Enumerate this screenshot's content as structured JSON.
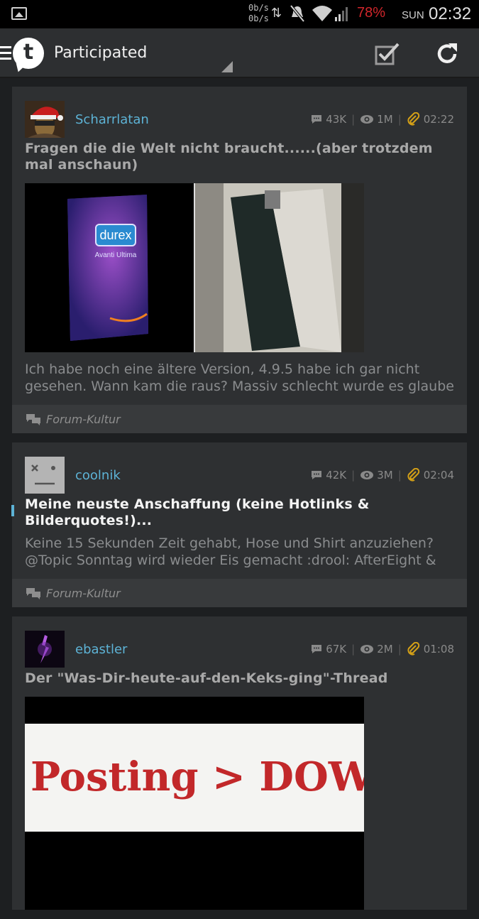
{
  "status_bar": {
    "net_up": "0b/s",
    "net_down": "0b/s",
    "battery": "78%",
    "day": "SUN",
    "time": "02:32"
  },
  "app_bar": {
    "logo_letter": "t",
    "title": "Participated"
  },
  "threads": [
    {
      "username": "Scharrlatan",
      "replies": "43K",
      "views": "1M",
      "time": "02:22",
      "title": "Fragen die die Welt nicht braucht......(aber trotzdem mal anschaun)",
      "excerpt": "Ich habe noch eine ältere Version, 4.9.5 habe ich gar nicht gesehen. Wann kam die raus? Massiv schlecht wurde es glaube",
      "forum": "Forum-Kultur",
      "image_text_brand": "durex",
      "image_text_product": "Avanti Ultima"
    },
    {
      "username": "coolnik",
      "replies": "42K",
      "views": "3M",
      "time": "02:04",
      "title": "Meine neuste Anschaffung (keine Hotlinks & Bilderquotes!)...",
      "excerpt": "Keine 15 Sekunden Zeit gehabt, Hose und Shirt anzuziehen? @Topic Sonntag wird wieder Eis gemacht :drool: AfterEight &",
      "forum": "Forum-Kultur"
    },
    {
      "username": "ebastler",
      "replies": "67K",
      "views": "2M",
      "time": "01:08",
      "title": "Der \"Was-Dir-heute-auf-den-Keks-ging\"-Thread",
      "image_text": "Posting > DOWN"
    }
  ],
  "colors": {
    "accent": "#5db3d6",
    "background": "#1d1f21",
    "card": "#2e3032",
    "attachment": "#d4a017",
    "battery": "#d0262b"
  }
}
